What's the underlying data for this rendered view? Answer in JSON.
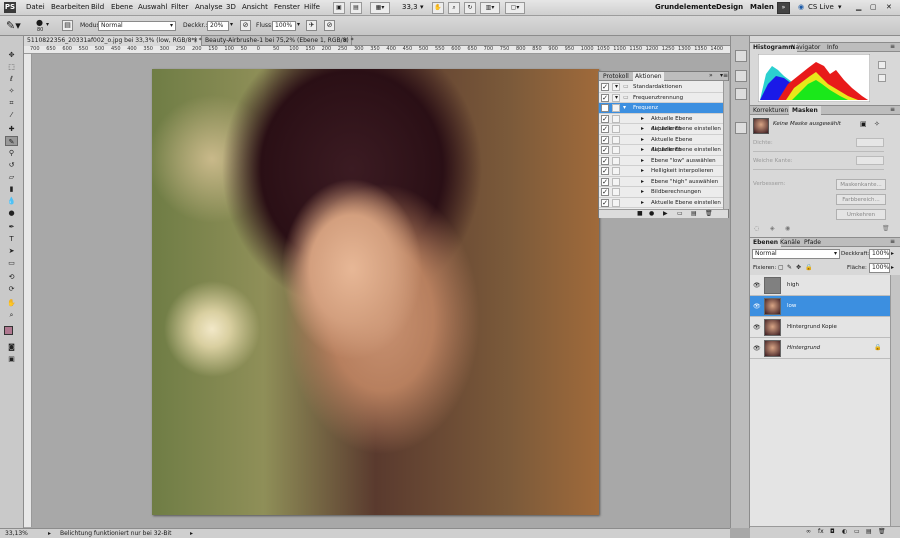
{
  "app": {
    "logo": "PS"
  },
  "menu": [
    "Datei",
    "Bearbeiten",
    "Bild",
    "Ebene",
    "Auswahl",
    "Filter",
    "Analyse",
    "3D",
    "Ansicht",
    "Fenster",
    "Hilfe"
  ],
  "menubar": {
    "zoom": "33,3",
    "workspaces": [
      "Grundelemente",
      "Design",
      "Malen"
    ],
    "more": "»",
    "cslive": "CS Live"
  },
  "options": {
    "mode_label": "Modus:",
    "mode_value": "Normal",
    "opacity_label": "Deckkr.:",
    "opacity_value": "20%",
    "flow_label": "Fluss:",
    "flow_value": "100%",
    "brush_size": "80"
  },
  "tabs": [
    {
      "label": "5110822356_20331af002_o.jpg bei 33,3% (low, RGB/8*) *",
      "close": "×"
    },
    {
      "label": "Beauty-Airbrushe-1 bei 75,2% (Ebene 1, RGB/8) *",
      "close": "×"
    }
  ],
  "ruler_ticks": [
    "700",
    "650",
    "600",
    "550",
    "500",
    "450",
    "400",
    "350",
    "300",
    "250",
    "200",
    "150",
    "100",
    "50",
    "0",
    "50",
    "100",
    "150",
    "200",
    "250",
    "300",
    "350",
    "400",
    "450",
    "500",
    "550",
    "600",
    "650",
    "700",
    "750",
    "800",
    "850",
    "900",
    "950",
    "1000",
    "1050",
    "1100",
    "1150",
    "1200",
    "1250",
    "1300",
    "1350",
    "1400"
  ],
  "status": {
    "zoom": "33,13%",
    "message": "Belichtung funktioniert nur bei 32-Bit"
  },
  "actions_panel": {
    "tabs": [
      "Protokoll",
      "Aktionen"
    ],
    "rows": [
      {
        "label": "Standardaktionen",
        "kind": "set"
      },
      {
        "label": "Frequenztrennung",
        "kind": "set"
      },
      {
        "label": "Frequenz",
        "kind": "action",
        "selected": true
      },
      {
        "label": "Aktuelle Ebene duplizieren",
        "kind": "step"
      },
      {
        "label": "Aktuelle Ebene einstellen",
        "kind": "step"
      },
      {
        "label": "Aktuelle Ebene duplizieren",
        "kind": "step"
      },
      {
        "label": "Aktuelle Ebene einstellen",
        "kind": "step"
      },
      {
        "label": "Ebene \"low\" auswählen",
        "kind": "step"
      },
      {
        "label": "Helligkeit interpolieren",
        "kind": "step"
      },
      {
        "label": "Ebene \"high\" auswählen",
        "kind": "step"
      },
      {
        "label": "Bildberechnungen",
        "kind": "step"
      },
      {
        "label": "Aktuelle Ebene einstellen",
        "kind": "step"
      }
    ]
  },
  "histogram_panel": {
    "tabs": [
      "Histogramm",
      "Navigator",
      "Info"
    ]
  },
  "masks_panel": {
    "tabs": [
      "Korrekturen",
      "Masken"
    ],
    "no_mask": "Keine Maske ausgewählt",
    "density_label": "Dichte:",
    "feather_label": "Weiche Kante:",
    "refine_label": "Verbessern:",
    "buttons": [
      "Maskenkante...",
      "Farbbereich...",
      "Umkehren"
    ]
  },
  "layers_panel": {
    "tabs": [
      "Ebenen",
      "Kanäle",
      "Pfade"
    ],
    "blend_mode": "Normal",
    "opacity_label": "Deckkraft:",
    "opacity_value": "100%",
    "lock_label": "Fixieren:",
    "fill_label": "Fläche:",
    "fill_value": "100%",
    "layers": [
      {
        "name": "high",
        "selected": false
      },
      {
        "name": "low",
        "selected": true
      },
      {
        "name": "Hintergrund Kopie",
        "selected": false
      },
      {
        "name": "Hintergrund",
        "selected": false,
        "locked": true
      }
    ]
  }
}
